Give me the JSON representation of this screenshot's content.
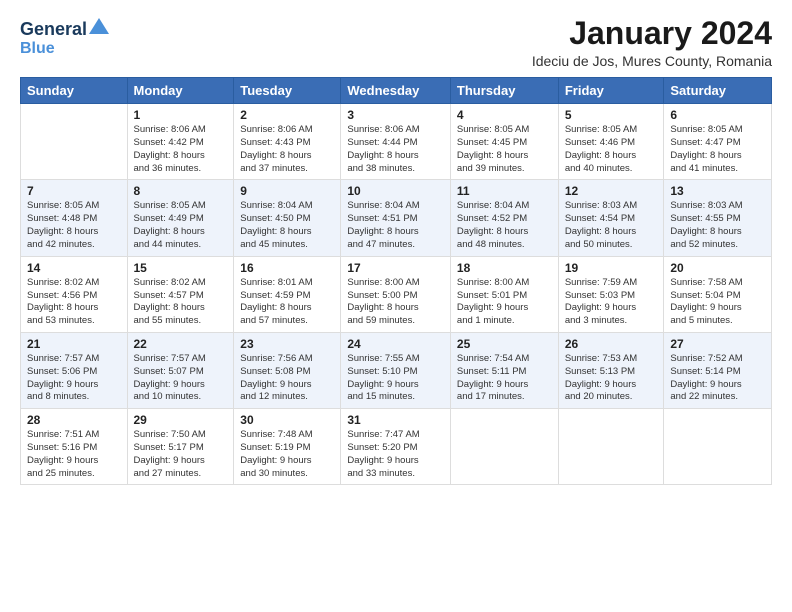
{
  "header": {
    "logo_line1": "General",
    "logo_line2": "Blue",
    "month_title": "January 2024",
    "location": "Ideciu de Jos, Mures County, Romania"
  },
  "days_of_week": [
    "Sunday",
    "Monday",
    "Tuesday",
    "Wednesday",
    "Thursday",
    "Friday",
    "Saturday"
  ],
  "weeks": [
    [
      {
        "day": "",
        "info": ""
      },
      {
        "day": "1",
        "info": "Sunrise: 8:06 AM\nSunset: 4:42 PM\nDaylight: 8 hours\nand 36 minutes."
      },
      {
        "day": "2",
        "info": "Sunrise: 8:06 AM\nSunset: 4:43 PM\nDaylight: 8 hours\nand 37 minutes."
      },
      {
        "day": "3",
        "info": "Sunrise: 8:06 AM\nSunset: 4:44 PM\nDaylight: 8 hours\nand 38 minutes."
      },
      {
        "day": "4",
        "info": "Sunrise: 8:05 AM\nSunset: 4:45 PM\nDaylight: 8 hours\nand 39 minutes."
      },
      {
        "day": "5",
        "info": "Sunrise: 8:05 AM\nSunset: 4:46 PM\nDaylight: 8 hours\nand 40 minutes."
      },
      {
        "day": "6",
        "info": "Sunrise: 8:05 AM\nSunset: 4:47 PM\nDaylight: 8 hours\nand 41 minutes."
      }
    ],
    [
      {
        "day": "7",
        "info": "Sunrise: 8:05 AM\nSunset: 4:48 PM\nDaylight: 8 hours\nand 42 minutes."
      },
      {
        "day": "8",
        "info": "Sunrise: 8:05 AM\nSunset: 4:49 PM\nDaylight: 8 hours\nand 44 minutes."
      },
      {
        "day": "9",
        "info": "Sunrise: 8:04 AM\nSunset: 4:50 PM\nDaylight: 8 hours\nand 45 minutes."
      },
      {
        "day": "10",
        "info": "Sunrise: 8:04 AM\nSunset: 4:51 PM\nDaylight: 8 hours\nand 47 minutes."
      },
      {
        "day": "11",
        "info": "Sunrise: 8:04 AM\nSunset: 4:52 PM\nDaylight: 8 hours\nand 48 minutes."
      },
      {
        "day": "12",
        "info": "Sunrise: 8:03 AM\nSunset: 4:54 PM\nDaylight: 8 hours\nand 50 minutes."
      },
      {
        "day": "13",
        "info": "Sunrise: 8:03 AM\nSunset: 4:55 PM\nDaylight: 8 hours\nand 52 minutes."
      }
    ],
    [
      {
        "day": "14",
        "info": "Sunrise: 8:02 AM\nSunset: 4:56 PM\nDaylight: 8 hours\nand 53 minutes."
      },
      {
        "day": "15",
        "info": "Sunrise: 8:02 AM\nSunset: 4:57 PM\nDaylight: 8 hours\nand 55 minutes."
      },
      {
        "day": "16",
        "info": "Sunrise: 8:01 AM\nSunset: 4:59 PM\nDaylight: 8 hours\nand 57 minutes."
      },
      {
        "day": "17",
        "info": "Sunrise: 8:00 AM\nSunset: 5:00 PM\nDaylight: 8 hours\nand 59 minutes."
      },
      {
        "day": "18",
        "info": "Sunrise: 8:00 AM\nSunset: 5:01 PM\nDaylight: 9 hours\nand 1 minute."
      },
      {
        "day": "19",
        "info": "Sunrise: 7:59 AM\nSunset: 5:03 PM\nDaylight: 9 hours\nand 3 minutes."
      },
      {
        "day": "20",
        "info": "Sunrise: 7:58 AM\nSunset: 5:04 PM\nDaylight: 9 hours\nand 5 minutes."
      }
    ],
    [
      {
        "day": "21",
        "info": "Sunrise: 7:57 AM\nSunset: 5:06 PM\nDaylight: 9 hours\nand 8 minutes."
      },
      {
        "day": "22",
        "info": "Sunrise: 7:57 AM\nSunset: 5:07 PM\nDaylight: 9 hours\nand 10 minutes."
      },
      {
        "day": "23",
        "info": "Sunrise: 7:56 AM\nSunset: 5:08 PM\nDaylight: 9 hours\nand 12 minutes."
      },
      {
        "day": "24",
        "info": "Sunrise: 7:55 AM\nSunset: 5:10 PM\nDaylight: 9 hours\nand 15 minutes."
      },
      {
        "day": "25",
        "info": "Sunrise: 7:54 AM\nSunset: 5:11 PM\nDaylight: 9 hours\nand 17 minutes."
      },
      {
        "day": "26",
        "info": "Sunrise: 7:53 AM\nSunset: 5:13 PM\nDaylight: 9 hours\nand 20 minutes."
      },
      {
        "day": "27",
        "info": "Sunrise: 7:52 AM\nSunset: 5:14 PM\nDaylight: 9 hours\nand 22 minutes."
      }
    ],
    [
      {
        "day": "28",
        "info": "Sunrise: 7:51 AM\nSunset: 5:16 PM\nDaylight: 9 hours\nand 25 minutes."
      },
      {
        "day": "29",
        "info": "Sunrise: 7:50 AM\nSunset: 5:17 PM\nDaylight: 9 hours\nand 27 minutes."
      },
      {
        "day": "30",
        "info": "Sunrise: 7:48 AM\nSunset: 5:19 PM\nDaylight: 9 hours\nand 30 minutes."
      },
      {
        "day": "31",
        "info": "Sunrise: 7:47 AM\nSunset: 5:20 PM\nDaylight: 9 hours\nand 33 minutes."
      },
      {
        "day": "",
        "info": ""
      },
      {
        "day": "",
        "info": ""
      },
      {
        "day": "",
        "info": ""
      }
    ]
  ]
}
